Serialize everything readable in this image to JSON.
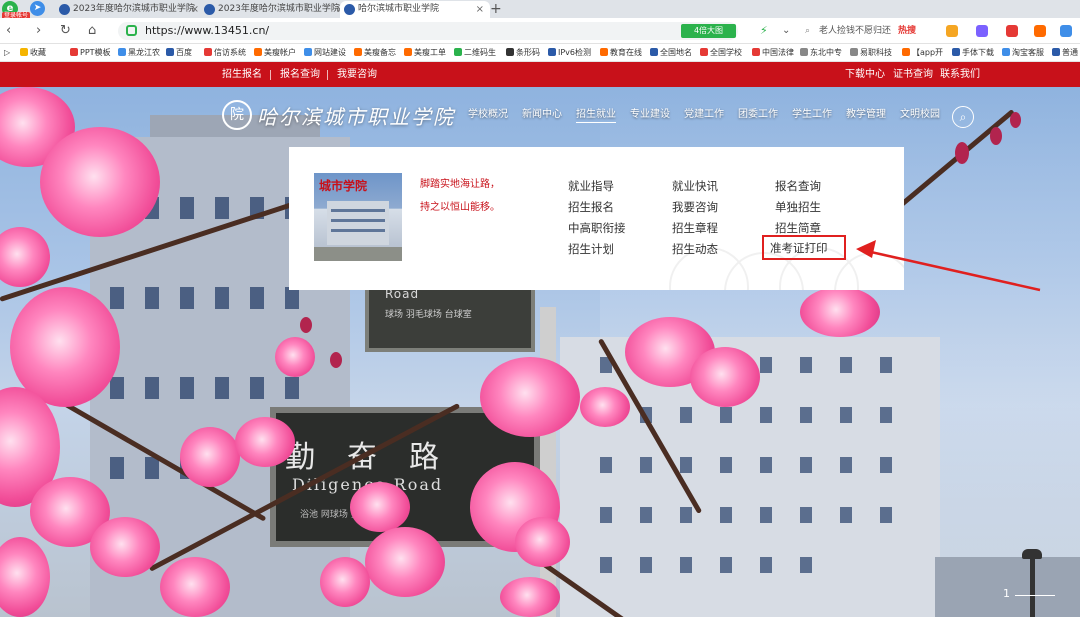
{
  "browser": {
    "logo": "e",
    "badge": "登录帐号",
    "tabs": [
      {
        "label": "2023年度哈尔滨城市职业学院"
      },
      {
        "label": "2023年度哈尔滨城市职业学院"
      },
      {
        "label": "哈尔滨城市职业学院"
      }
    ],
    "new_tab": "+",
    "url": "https://www.13451.cn/",
    "big_view_label": "4倍大图",
    "search_text": "老人捡钱不愿归还",
    "hot_label": "热搜",
    "bookmarks": [
      "收藏",
      "PPT模板",
      "黑龙江农",
      "百度",
      "信访系统",
      "美瘦帐户",
      "网站建设",
      "美瘦备忘",
      "美瘦工单",
      "二维码生",
      "条形码",
      "IPv6检测",
      "教育在线",
      "全国地名",
      "全国学校",
      "中国法律",
      "东北中专",
      "易职科技",
      "【app开",
      "手体下载",
      "淘宝客服",
      "普通"
    ]
  },
  "site": {
    "top_links_left": [
      "招生报名",
      "报名查询",
      "我要咨询"
    ],
    "top_links_right": [
      "下载中心",
      "证书查询",
      "联系我们"
    ],
    "logo_text": "哈尔滨城市职业学院",
    "nav": [
      "学校概况",
      "新闻中心",
      "招生就业",
      "专业建设",
      "党建工作",
      "团委工作",
      "学生工作",
      "教学管理",
      "文明校园"
    ],
    "active_nav": "招生就业",
    "dropdown": {
      "photo_title": "城市学院",
      "slogan_lines": [
        "脚踏实地海让路，",
        "持之以恒山能移。"
      ],
      "columns": [
        [
          "就业指导",
          "招生报名",
          "中高职衔接",
          "招生计划"
        ],
        [
          "就业快讯",
          "我要咨询",
          "招生章程",
          "招生动态"
        ],
        [
          "报名查询",
          "单独招生",
          "招生简章",
          "准考证打印"
        ]
      ],
      "highlighted": "准考证打印"
    },
    "hero": {
      "sign_upper_line1": "Road",
      "sign_upper_line2": "球场 羽毛球场 台球室",
      "sign_cn": "勤奋路",
      "sign_en": "Diligence Road",
      "sign_sub": "浴池 网球场 实训",
      "pager": "1"
    }
  },
  "colors": {
    "brand_red": "#c8111a",
    "highlight_red": "#e0201f",
    "browser_green": "#2bb24c"
  }
}
